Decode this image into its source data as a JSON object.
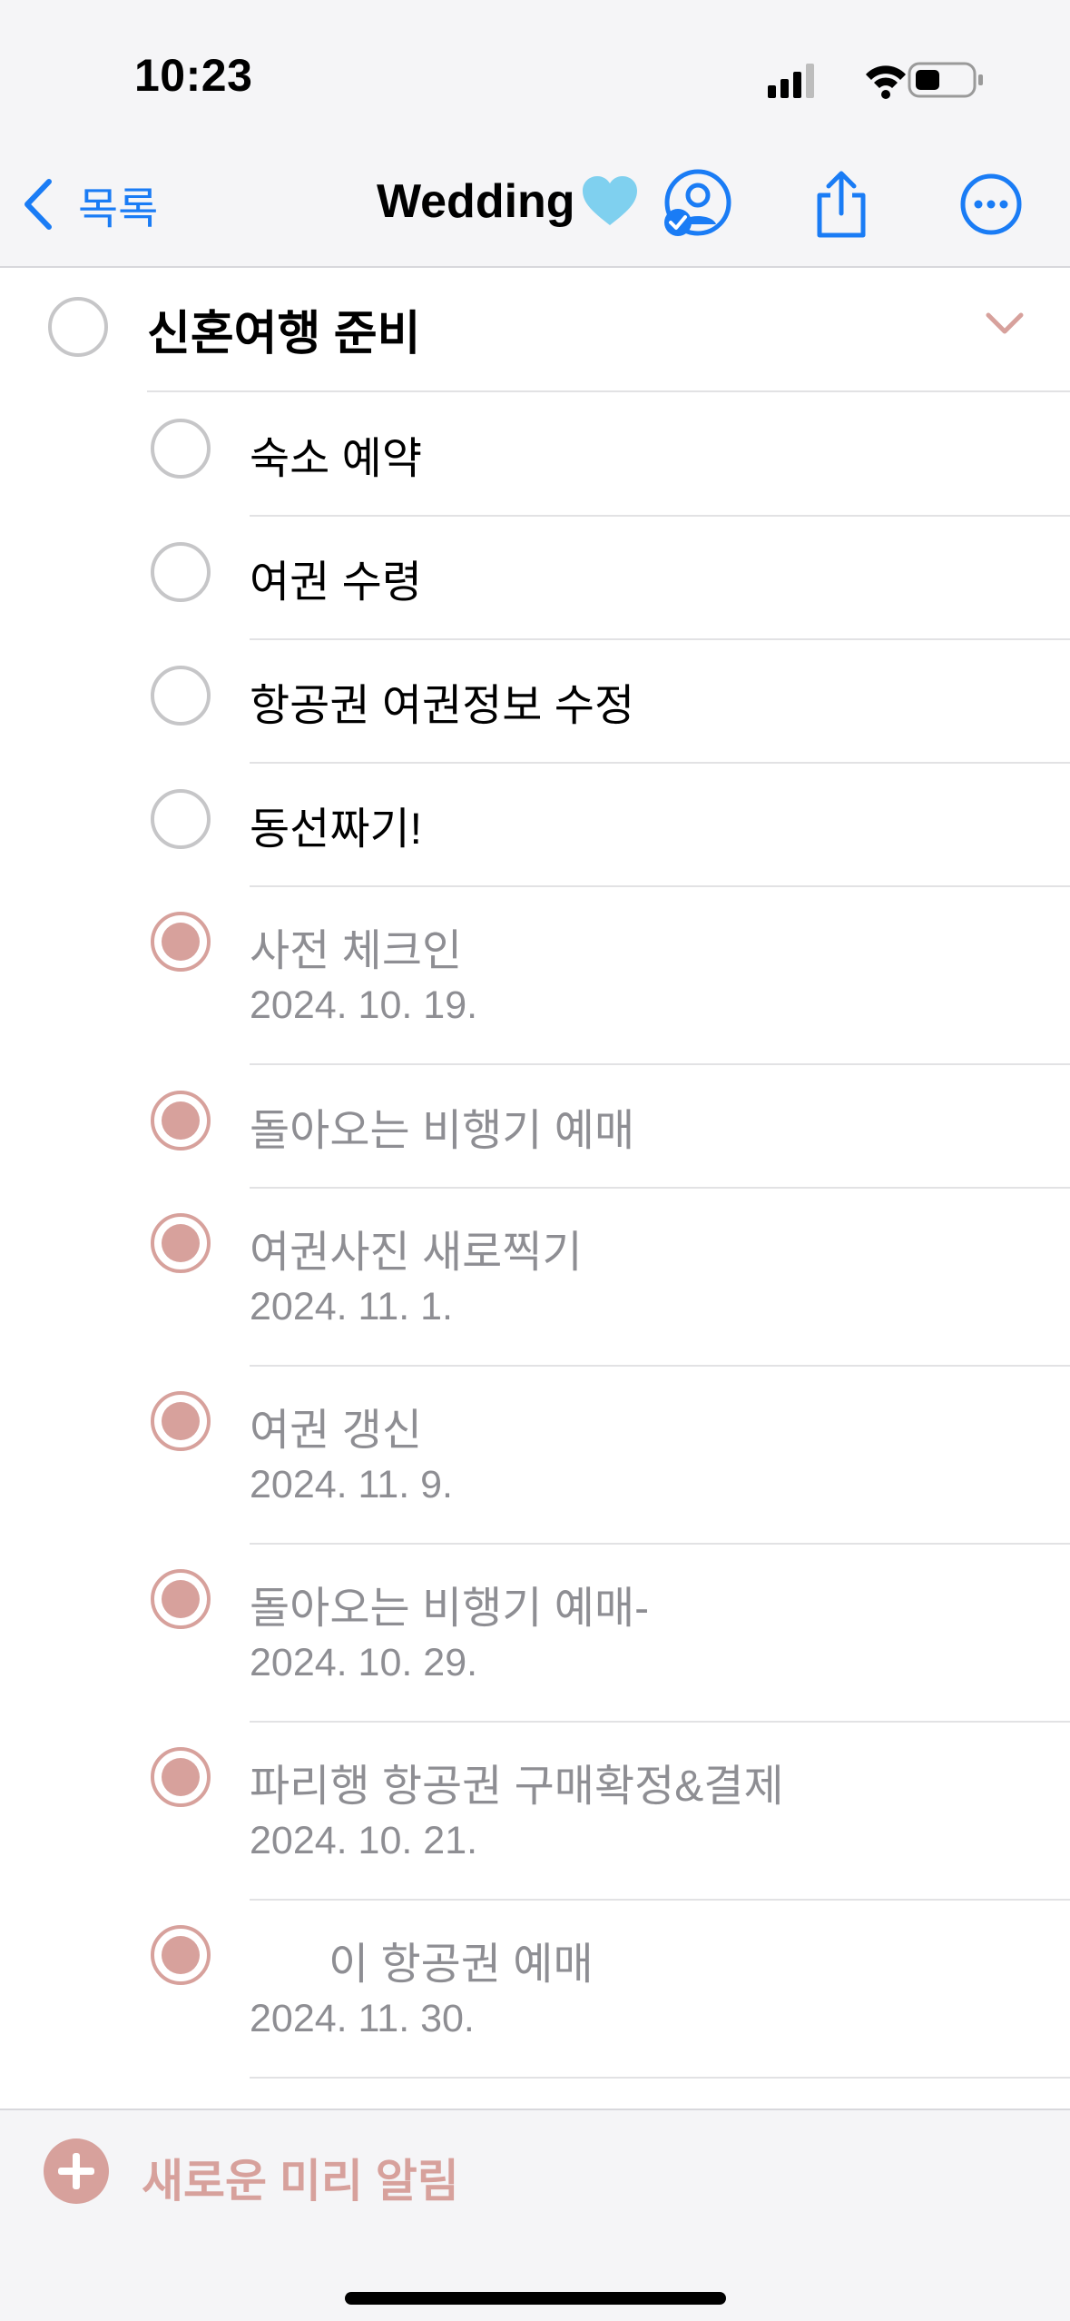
{
  "status_bar": {
    "time": "10:23"
  },
  "nav": {
    "back_label": "목록",
    "title": "Wedding",
    "title_emoji": "light-blue-heart-icon"
  },
  "group": {
    "title": "신혼여행 준비"
  },
  "items": [
    {
      "title": "숙소 예약",
      "date": "",
      "completed": false
    },
    {
      "title": "여권 수령",
      "date": "",
      "completed": false
    },
    {
      "title": "항공권 여권정보 수정",
      "date": "",
      "completed": false
    },
    {
      "title": "동선짜기!",
      "date": "",
      "completed": false
    },
    {
      "title": "사전 체크인",
      "date": "2024. 10. 19.",
      "completed": true
    },
    {
      "title": "돌아오는 비행기 예매",
      "date": "",
      "completed": true
    },
    {
      "title": "여권사진 새로찍기",
      "date": "2024. 11. 1.",
      "completed": true
    },
    {
      "title": "여권 갱신",
      "date": "2024. 11. 9.",
      "completed": true
    },
    {
      "title": "돌아오는 비행기 예매-",
      "date": "2024. 10. 29.",
      "completed": true
    },
    {
      "title": "파리행 항공권 구매확정&결제",
      "date": "2024. 10. 21.",
      "completed": true
    },
    {
      "title": "이 항공권 예매",
      "date": "2024. 11. 30.",
      "completed": true
    }
  ],
  "footer": {
    "add_label": "새로운 미리 알림"
  },
  "colors": {
    "accent_blue": "#1a7cf5",
    "completed_pink": "#d7a19c",
    "muted_text": "#8e8e93"
  }
}
